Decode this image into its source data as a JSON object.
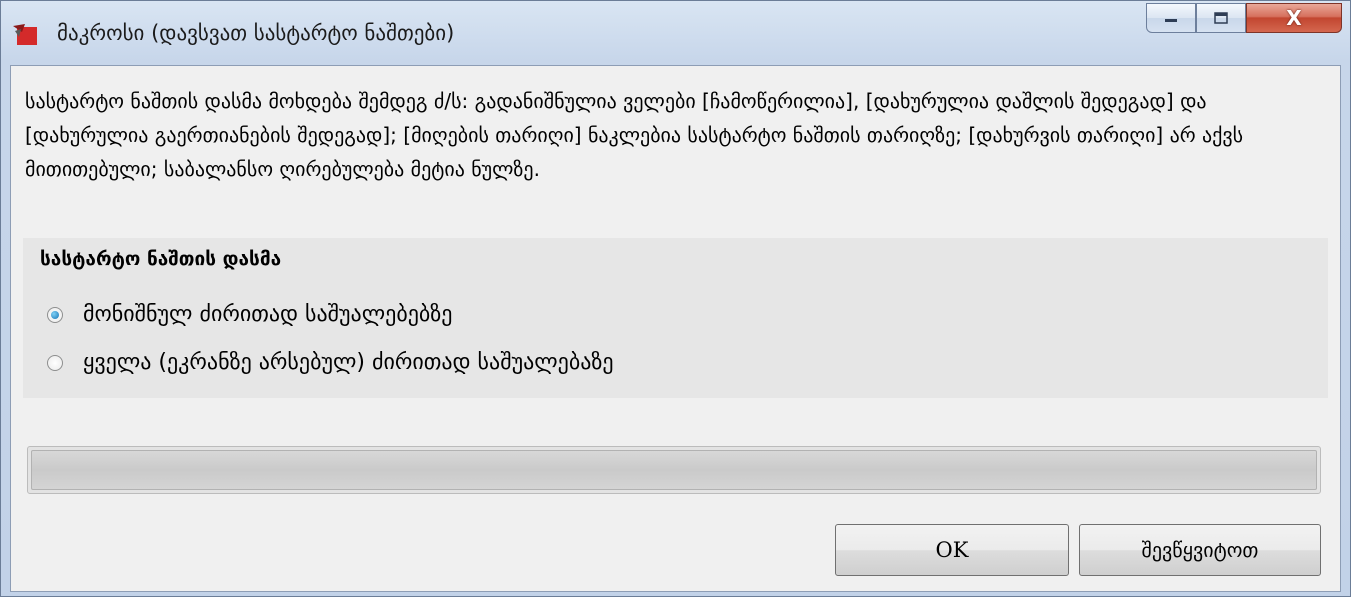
{
  "window": {
    "title": "მაკროსი (დავსვათ სასტარტო ნაშთები)",
    "close_symbol": "X"
  },
  "description": "სასტარტო ნაშთის დასმა მოხდება შემდეგ ძ/ს: გადანიშნულია ველები [ჩამოწერილია], [დახურულია დაშლის შედეგად] და [დახურულია გაერთიანების შედეგად]; [მიღების თარიღი] ნაკლებია სასტარტო ნაშთის თარიღზე; [დახურვის თარიღი] არ აქვს მითითებული; საბალანსო ღირებულება მეტია ნულზე.",
  "group": {
    "title": "სასტარტო ნაშთის დასმა",
    "options": [
      {
        "label": "მონიშნულ ძირითად საშუალებებზე",
        "checked": true
      },
      {
        "label": "ყველა (ეკრანზე არსებულ) ძირითად საშუალებაზე",
        "checked": false
      }
    ]
  },
  "progress": {
    "value": 0
  },
  "buttons": {
    "ok": "OK",
    "cancel": "შევწყვიტოთ"
  },
  "colors": {
    "title_bar": "#c7d6ea",
    "client_bg": "#f0f0f0",
    "close_button": "#c24630",
    "radio_checked": "#1674b5",
    "app_icon_red": "#d42a2a"
  },
  "icons": {
    "app": "app-logo-icon",
    "minimize": "minimize-icon",
    "maximize": "maximize-icon",
    "close": "close-icon"
  }
}
